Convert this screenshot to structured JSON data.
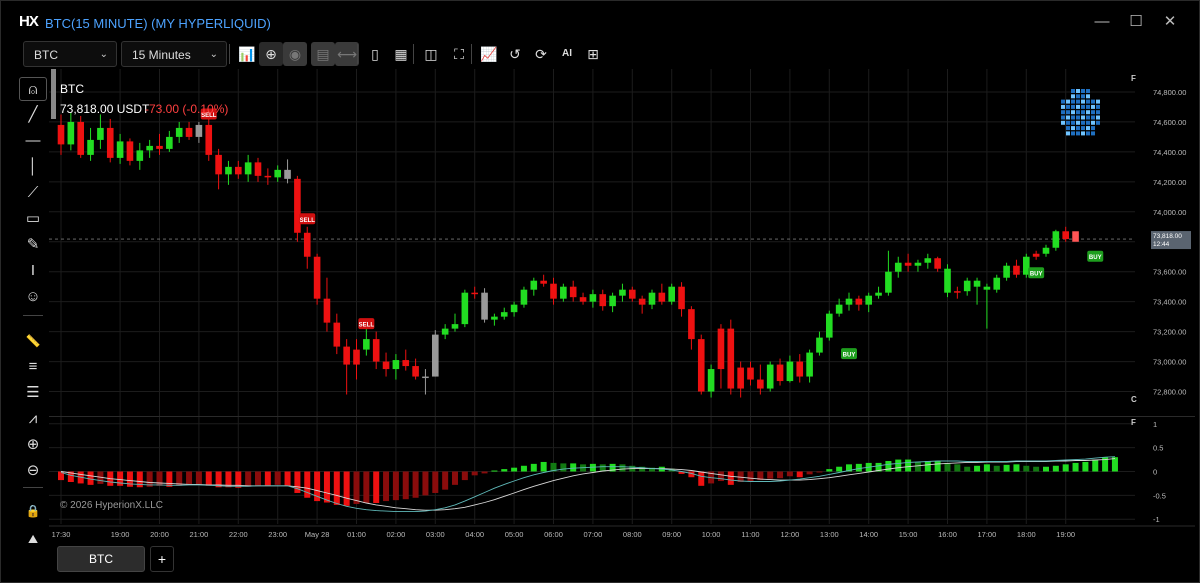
{
  "window": {
    "logo": "HX",
    "title": "BTC(15 MINUTE) (MY HYPERLIQUID)",
    "minimize": "—",
    "maximize": "☐",
    "close": "✕"
  },
  "toolbar": {
    "symbol": "BTC",
    "interval": "15 Minutes",
    "buttons": [
      {
        "name": "add-indicator-icon",
        "glyph": "📊"
      },
      {
        "name": "crosshair-icon",
        "glyph": "⊕"
      },
      {
        "name": "snapshot-icon",
        "glyph": "◉"
      },
      {
        "name": "save-layout-icon",
        "glyph": "▤"
      },
      {
        "name": "fit-width-icon",
        "glyph": "⟷"
      },
      {
        "name": "document-icon",
        "glyph": "▯"
      },
      {
        "name": "notes-icon",
        "glyph": "▦"
      },
      {
        "name": "panel-toggle-icon",
        "glyph": "◫"
      },
      {
        "name": "fullscreen-icon",
        "glyph": "⛶"
      },
      {
        "name": "chart-type-icon",
        "glyph": "📈"
      },
      {
        "name": "replay-icon",
        "glyph": "↺"
      },
      {
        "name": "refresh-icon",
        "glyph": "⟳"
      },
      {
        "name": "ai-icon",
        "glyph": "AI"
      },
      {
        "name": "grid-layout-icon",
        "glyph": "⊞"
      }
    ]
  },
  "left_tools": [
    {
      "name": "cursor-tool-icon",
      "glyph": "⍝"
    },
    {
      "name": "trend-line-tool-icon",
      "glyph": "╱"
    },
    {
      "name": "horizontal-line-tool-icon",
      "glyph": "—"
    },
    {
      "name": "vertical-line-tool-icon",
      "glyph": "│"
    },
    {
      "name": "ray-tool-icon",
      "glyph": "⟋"
    },
    {
      "name": "rectangle-tool-icon",
      "glyph": "▭"
    },
    {
      "name": "brush-tool-icon",
      "glyph": "✎"
    },
    {
      "name": "text-tool-icon",
      "glyph": "I"
    },
    {
      "name": "emoji-tool-icon",
      "glyph": "☺"
    },
    {
      "name": "ruler-tool-icon",
      "glyph": "📏"
    },
    {
      "name": "fib-tool-icon",
      "glyph": "≡"
    },
    {
      "name": "channel-tool-icon",
      "glyph": "☰"
    },
    {
      "name": "pattern-tool-icon",
      "glyph": "⩘"
    },
    {
      "name": "zoom-in-icon",
      "glyph": "⊕"
    },
    {
      "name": "zoom-out-icon",
      "glyph": "⊖"
    },
    {
      "name": "lock-icon",
      "glyph": "🔒"
    },
    {
      "name": "hide-drawings-icon",
      "glyph": "⛰"
    }
  ],
  "hud": {
    "symbol": "BTC",
    "price": "73,818.00 USDT",
    "change": "-73.00 (-0.10%)",
    "copyright": "© 2026 HyperionX.LLC"
  },
  "colors": {
    "up": "#22dd22",
    "down": "#ee1111",
    "neutral": "#999999",
    "background": "#000000",
    "grid": "#1c1c1c",
    "macd_line": "#5fb8b8",
    "signal_line": "#d8d8d8",
    "title_blue": "#4da3ff"
  },
  "chart_data": {
    "type": "candlestick",
    "symbol": "BTC",
    "interval": "15 Minutes",
    "price_axis": {
      "min": 72650,
      "max": 74900,
      "ticks": [
        72800,
        73000,
        73200,
        73400,
        73600,
        73800,
        74000,
        74200,
        74400,
        74600,
        74800
      ],
      "tick_labels": [
        "72,800.00",
        "73,000.00",
        "73,200.00",
        "73,400.00",
        "73,600.00",
        "73,800.00",
        "74,000.00",
        "74,200.00",
        "74,400.00",
        "74,600.00",
        "74,800.00"
      ]
    },
    "last_price": {
      "label": "73,818.00",
      "countdown": "12:44",
      "value": 73818
    },
    "time_axis": {
      "labels": [
        "17:30",
        "19:00",
        "20:00",
        "21:00",
        "22:00",
        "23:00",
        "May 28",
        "01:00",
        "02:00",
        "03:00",
        "04:00",
        "05:00",
        "06:00",
        "07:00",
        "08:00",
        "09:00",
        "10:00",
        "11:00",
        "12:00",
        "13:00",
        "14:00",
        "15:00",
        "16:00",
        "17:00",
        "18:00",
        "19:00"
      ],
      "label_index": [
        0,
        6,
        10,
        14,
        18,
        22,
        26,
        30,
        34,
        38,
        42,
        46,
        50,
        54,
        58,
        62,
        66,
        70,
        74,
        78,
        82,
        86,
        90,
        94,
        98,
        102
      ]
    },
    "candles": [
      [
        74580,
        74650,
        74380,
        74450,
        "d"
      ],
      [
        74450,
        74660,
        74410,
        74600,
        "u"
      ],
      [
        74600,
        74640,
        74360,
        74380,
        "d"
      ],
      [
        74380,
        74560,
        74340,
        74480,
        "u"
      ],
      [
        74480,
        74650,
        74420,
        74560,
        "u"
      ],
      [
        74560,
        74620,
        74330,
        74360,
        "d"
      ],
      [
        74360,
        74520,
        74320,
        74470,
        "u"
      ],
      [
        74470,
        74490,
        74310,
        74340,
        "d"
      ],
      [
        74340,
        74460,
        74280,
        74410,
        "u"
      ],
      [
        74410,
        74480,
        74360,
        74440,
        "u"
      ],
      [
        74440,
        74520,
        74380,
        74420,
        "d"
      ],
      [
        74420,
        74540,
        74400,
        74500,
        "u"
      ],
      [
        74500,
        74600,
        74460,
        74560,
        "u"
      ],
      [
        74560,
        74600,
        74480,
        74500,
        "d"
      ],
      [
        74500,
        74600,
        74460,
        74580,
        "n"
      ],
      [
        74580,
        74620,
        74340,
        74380,
        "d"
      ],
      [
        74380,
        74420,
        74150,
        74250,
        "d"
      ],
      [
        74250,
        74340,
        74180,
        74300,
        "u"
      ],
      [
        74300,
        74340,
        74220,
        74250,
        "d"
      ],
      [
        74250,
        74380,
        74200,
        74330,
        "u"
      ],
      [
        74330,
        74360,
        74200,
        74240,
        "d"
      ],
      [
        74240,
        74290,
        74180,
        74230,
        "d"
      ],
      [
        74230,
        74310,
        74200,
        74280,
        "u"
      ],
      [
        74280,
        74350,
        74190,
        74220,
        "n"
      ],
      [
        74220,
        74240,
        73800,
        73860,
        "d"
      ],
      [
        73860,
        73900,
        73620,
        73700,
        "d"
      ],
      [
        73700,
        73720,
        73380,
        73420,
        "d"
      ],
      [
        73420,
        73560,
        73200,
        73260,
        "d"
      ],
      [
        73260,
        73320,
        73050,
        73100,
        "d"
      ],
      [
        73100,
        73150,
        72780,
        72980,
        "d"
      ],
      [
        72980,
        73150,
        72880,
        73080,
        "d"
      ],
      [
        73080,
        73220,
        73040,
        73150,
        "u"
      ],
      [
        73150,
        73200,
        72950,
        73000,
        "d"
      ],
      [
        73000,
        73060,
        72900,
        72950,
        "d"
      ],
      [
        72950,
        73050,
        72880,
        73010,
        "u"
      ],
      [
        73010,
        73080,
        72940,
        72970,
        "d"
      ],
      [
        72970,
        73020,
        72880,
        72900,
        "d"
      ],
      [
        72900,
        72950,
        72780,
        72900,
        "n"
      ],
      [
        72900,
        73210,
        72900,
        73180,
        "n"
      ],
      [
        73180,
        73250,
        73150,
        73220,
        "u"
      ],
      [
        73220,
        73320,
        73200,
        73250,
        "u"
      ],
      [
        73250,
        73480,
        73230,
        73460,
        "u"
      ],
      [
        73460,
        73500,
        73420,
        73460,
        "d"
      ],
      [
        73460,
        73490,
        73260,
        73280,
        "n"
      ],
      [
        73280,
        73320,
        73240,
        73300,
        "u"
      ],
      [
        73300,
        73360,
        73280,
        73330,
        "u"
      ],
      [
        73330,
        73400,
        73300,
        73380,
        "u"
      ],
      [
        73380,
        73500,
        73360,
        73480,
        "u"
      ],
      [
        73480,
        73560,
        73440,
        73540,
        "u"
      ],
      [
        73540,
        73580,
        73500,
        73520,
        "d"
      ],
      [
        73520,
        73560,
        73380,
        73420,
        "d"
      ],
      [
        73420,
        73520,
        73400,
        73500,
        "u"
      ],
      [
        73500,
        73540,
        73400,
        73430,
        "d"
      ],
      [
        73430,
        73460,
        73380,
        73400,
        "d"
      ],
      [
        73400,
        73480,
        73360,
        73450,
        "u"
      ],
      [
        73450,
        73480,
        73340,
        73370,
        "d"
      ],
      [
        73370,
        73460,
        73330,
        73440,
        "u"
      ],
      [
        73440,
        73520,
        73400,
        73480,
        "u"
      ],
      [
        73480,
        73500,
        73400,
        73420,
        "d"
      ],
      [
        73420,
        73440,
        73320,
        73380,
        "d"
      ],
      [
        73380,
        73480,
        73350,
        73460,
        "u"
      ],
      [
        73460,
        73520,
        73380,
        73400,
        "d"
      ],
      [
        73400,
        73520,
        73380,
        73500,
        "u"
      ],
      [
        73500,
        73530,
        73300,
        73350,
        "d"
      ],
      [
        73350,
        73370,
        73080,
        73150,
        "d"
      ],
      [
        73150,
        73180,
        72780,
        72800,
        "d"
      ],
      [
        72800,
        72980,
        72760,
        72950,
        "u"
      ],
      [
        72950,
        73250,
        72820,
        73220,
        "d"
      ],
      [
        73220,
        73280,
        72780,
        72820,
        "d"
      ],
      [
        72820,
        73000,
        72760,
        72960,
        "d"
      ],
      [
        72960,
        73000,
        72840,
        72880,
        "d"
      ],
      [
        72880,
        72980,
        72780,
        72820,
        "d"
      ],
      [
        72820,
        73000,
        72800,
        72980,
        "u"
      ],
      [
        72980,
        73020,
        72840,
        72870,
        "d"
      ],
      [
        72870,
        73040,
        72860,
        73000,
        "u"
      ],
      [
        73000,
        73050,
        72860,
        72900,
        "d"
      ],
      [
        72900,
        73080,
        72860,
        73060,
        "u"
      ],
      [
        73060,
        73200,
        73040,
        73160,
        "u"
      ],
      [
        73160,
        73340,
        73140,
        73320,
        "u"
      ],
      [
        73320,
        73420,
        73300,
        73380,
        "u"
      ],
      [
        73380,
        73460,
        73340,
        73420,
        "u"
      ],
      [
        73420,
        73440,
        73340,
        73380,
        "d"
      ],
      [
        73380,
        73460,
        73330,
        73440,
        "u"
      ],
      [
        73440,
        73500,
        73420,
        73460,
        "u"
      ],
      [
        73460,
        73740,
        73440,
        73600,
        "u"
      ],
      [
        73600,
        73700,
        73560,
        73660,
        "u"
      ],
      [
        73660,
        73720,
        73600,
        73640,
        "d"
      ],
      [
        73640,
        73680,
        73600,
        73660,
        "u"
      ],
      [
        73660,
        73720,
        73620,
        73690,
        "u"
      ],
      [
        73690,
        73700,
        73600,
        73620,
        "d"
      ],
      [
        73620,
        73650,
        73430,
        73460,
        "u"
      ],
      [
        73460,
        73500,
        73420,
        73470,
        "d"
      ],
      [
        73470,
        73560,
        73440,
        73540,
        "u"
      ],
      [
        73540,
        73560,
        73380,
        73500,
        "u"
      ],
      [
        73500,
        73520,
        73220,
        73480,
        "u"
      ],
      [
        73480,
        73580,
        73460,
        73560,
        "u"
      ],
      [
        73560,
        73660,
        73540,
        73640,
        "u"
      ],
      [
        73640,
        73680,
        73560,
        73580,
        "d"
      ],
      [
        73580,
        73720,
        73560,
        73700,
        "u"
      ],
      [
        73700,
        73740,
        73680,
        73720,
        "d"
      ],
      [
        73720,
        73780,
        73700,
        73760,
        "u"
      ],
      [
        73760,
        73880,
        73740,
        73870,
        "u"
      ],
      [
        73870,
        73900,
        73800,
        73818,
        "d"
      ]
    ],
    "signals": [
      {
        "label": "SELL",
        "index": 15,
        "price": 74650
      },
      {
        "label": "SELL",
        "index": 25,
        "price": 73950
      },
      {
        "label": "SELL",
        "index": 31,
        "price": 73250
      },
      {
        "label": "BUY",
        "index": 80,
        "price": 73050
      },
      {
        "label": "BUY",
        "index": 99,
        "price": 73590
      },
      {
        "label": "BUY",
        "index": 105,
        "price": 73700
      }
    ],
    "indicator": {
      "name": "MACD",
      "axis": {
        "min": -1.1,
        "max": 1.1,
        "ticks": [
          1,
          0.5,
          0,
          -0.5,
          -1
        ],
        "tick_labels": [
          "1",
          "0.5",
          "0",
          "-0.5",
          "-1"
        ]
      },
      "histogram": [
        -0.18,
        -0.22,
        -0.25,
        -0.28,
        -0.26,
        -0.3,
        -0.3,
        -0.32,
        -0.33,
        -0.32,
        -0.3,
        -0.32,
        -0.3,
        -0.28,
        -0.27,
        -0.3,
        -0.33,
        -0.33,
        -0.34,
        -0.32,
        -0.3,
        -0.3,
        -0.28,
        -0.3,
        -0.45,
        -0.55,
        -0.62,
        -0.65,
        -0.7,
        -0.72,
        -0.68,
        -0.66,
        -0.66,
        -0.62,
        -0.6,
        -0.58,
        -0.55,
        -0.5,
        -0.45,
        -0.38,
        -0.28,
        -0.18,
        -0.08,
        -0.04,
        0.02,
        0.05,
        0.08,
        0.12,
        0.16,
        0.2,
        0.18,
        0.17,
        0.17,
        0.15,
        0.16,
        0.15,
        0.16,
        0.15,
        0.12,
        0.1,
        0.08,
        0.1,
        0.06,
        -0.05,
        -0.12,
        -0.3,
        -0.25,
        -0.2,
        -0.28,
        -0.22,
        -0.2,
        -0.18,
        -0.15,
        -0.14,
        -0.1,
        -0.12,
        -0.06,
        -0.02,
        0.05,
        0.1,
        0.15,
        0.16,
        0.18,
        0.18,
        0.22,
        0.25,
        0.25,
        0.2,
        0.22,
        0.22,
        0.18,
        0.15,
        0.1,
        0.12,
        0.15,
        0.12,
        0.14,
        0.15,
        0.12,
        0.1,
        0.1,
        0.12,
        0.15,
        0.18,
        0.2,
        0.25,
        0.3,
        0.3
      ],
      "macd_line": [
        -0.02,
        -0.08,
        -0.12,
        -0.16,
        -0.19,
        -0.22,
        -0.24,
        -0.26,
        -0.27,
        -0.28,
        -0.28,
        -0.29,
        -0.29,
        -0.28,
        -0.28,
        -0.29,
        -0.3,
        -0.31,
        -0.31,
        -0.31,
        -0.3,
        -0.3,
        -0.3,
        -0.3,
        -0.36,
        -0.44,
        -0.52,
        -0.6,
        -0.67,
        -0.73,
        -0.77,
        -0.8,
        -0.82,
        -0.83,
        -0.84,
        -0.84,
        -0.84,
        -0.83,
        -0.8,
        -0.76,
        -0.7,
        -0.62,
        -0.53,
        -0.44,
        -0.35,
        -0.27,
        -0.2,
        -0.13,
        -0.07,
        -0.02,
        0.02,
        0.05,
        0.07,
        0.08,
        0.09,
        0.1,
        0.1,
        0.1,
        0.09,
        0.08,
        0.06,
        0.05,
        0.03,
        0.0,
        -0.04,
        -0.1,
        -0.13,
        -0.15,
        -0.18,
        -0.2,
        -0.21,
        -0.21,
        -0.21,
        -0.2,
        -0.18,
        -0.16,
        -0.13,
        -0.1,
        -0.06,
        -0.02,
        0.02,
        0.06,
        0.09,
        0.12,
        0.15,
        0.17,
        0.19,
        0.2,
        0.21,
        0.22,
        0.22,
        0.22,
        0.21,
        0.21,
        0.21,
        0.21,
        0.21,
        0.22,
        0.22,
        0.22,
        0.22,
        0.23,
        0.24,
        0.25,
        0.26,
        0.28,
        0.3,
        0.31
      ],
      "signal_line": [
        0.0,
        -0.03,
        -0.06,
        -0.09,
        -0.12,
        -0.15,
        -0.17,
        -0.19,
        -0.21,
        -0.23,
        -0.24,
        -0.25,
        -0.26,
        -0.27,
        -0.27,
        -0.28,
        -0.28,
        -0.29,
        -0.29,
        -0.3,
        -0.3,
        -0.3,
        -0.3,
        -0.3,
        -0.32,
        -0.35,
        -0.4,
        -0.45,
        -0.5,
        -0.56,
        -0.61,
        -0.66,
        -0.7,
        -0.73,
        -0.76,
        -0.78,
        -0.8,
        -0.81,
        -0.81,
        -0.8,
        -0.78,
        -0.75,
        -0.7,
        -0.65,
        -0.59,
        -0.52,
        -0.45,
        -0.38,
        -0.31,
        -0.25,
        -0.19,
        -0.14,
        -0.09,
        -0.05,
        -0.02,
        0.01,
        0.03,
        0.05,
        0.06,
        0.06,
        0.06,
        0.06,
        0.05,
        0.04,
        0.02,
        -0.01,
        -0.04,
        -0.07,
        -0.1,
        -0.12,
        -0.14,
        -0.16,
        -0.17,
        -0.18,
        -0.18,
        -0.18,
        -0.17,
        -0.15,
        -0.13,
        -0.1,
        -0.07,
        -0.04,
        -0.01,
        0.02,
        0.05,
        0.08,
        0.1,
        0.12,
        0.14,
        0.16,
        0.17,
        0.18,
        0.19,
        0.19,
        0.2,
        0.2,
        0.2,
        0.21,
        0.21,
        0.21,
        0.21,
        0.22,
        0.22,
        0.23,
        0.23,
        0.24,
        0.25,
        0.27
      ]
    },
    "grid": true,
    "pane_labels": [
      "F",
      "C",
      "F"
    ]
  }
}
